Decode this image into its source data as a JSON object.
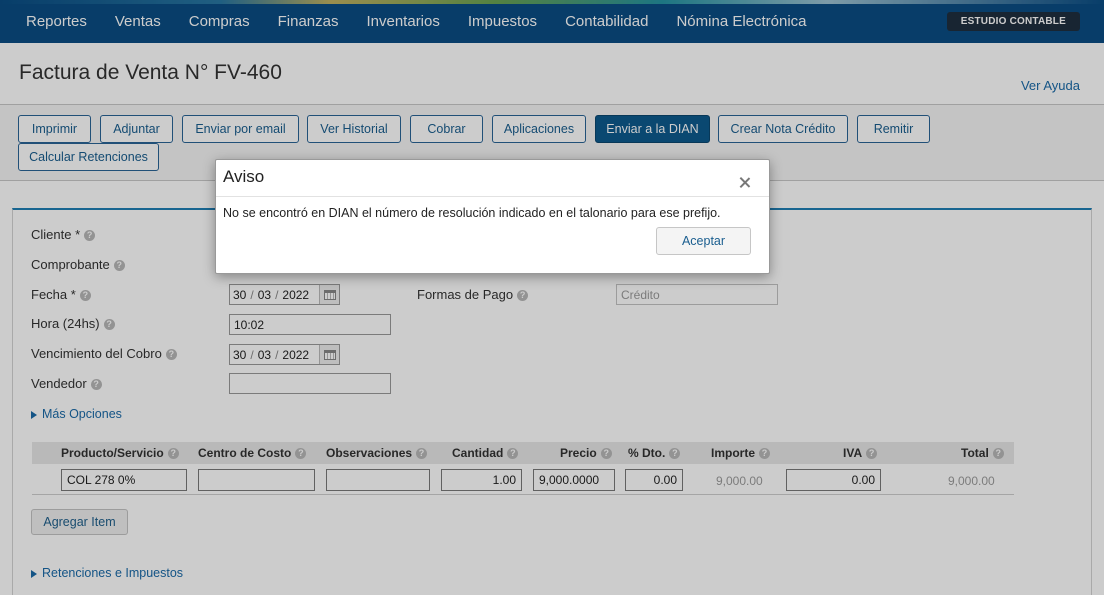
{
  "nav": {
    "items": [
      "Reportes",
      "Ventas",
      "Compras",
      "Finanzas",
      "Inventarios",
      "Impuestos",
      "Contabilidad",
      "Nómina Electrónica"
    ],
    "studio_label": "ESTUDIO CONTABLE"
  },
  "page": {
    "title": "Factura de Venta N° FV-460",
    "help_link": "Ver Ayuda"
  },
  "toolbar": {
    "buttons": [
      "Imprimir",
      "Adjuntar",
      "Enviar por email",
      "Ver Historial",
      "Cobrar",
      "Aplicaciones",
      "Enviar a la DIAN",
      "Crear Nota Crédito",
      "Remitir",
      "Calcular Retenciones"
    ]
  },
  "form": {
    "labels": {
      "cliente": "Cliente *",
      "comprobante": "Comprobante",
      "fecha": "Fecha *",
      "hora": "Hora (24hs)",
      "vencimiento": "Vencimiento del Cobro",
      "vendedor": "Vendedor",
      "formas_pago": "Formas de Pago"
    },
    "fecha": {
      "day": "30",
      "month": "03",
      "year": "2022"
    },
    "hora_value": "10:02",
    "vencimiento": {
      "day": "30",
      "month": "03",
      "year": "2022"
    },
    "vendedor_value": "",
    "formas_pago_placeholder": "Crédito",
    "mas_opciones": "Más Opciones"
  },
  "items_table": {
    "headers": [
      "Producto/Servicio",
      "Centro de Costo",
      "Observaciones",
      "Cantidad",
      "Precio",
      "% Dto.",
      "Importe",
      "IVA",
      "Total"
    ],
    "row": {
      "producto": "COL 278 0%",
      "centro_costo": "",
      "observaciones": "",
      "cantidad": "1.00",
      "precio": "9,000.0000",
      "dto": "0.00",
      "importe": "9,000.00",
      "iva": "0.00",
      "total": "9,000.00"
    },
    "add_item": "Agregar Item"
  },
  "retenciones_link": "Retenciones e Impuestos",
  "dialog": {
    "title": "Aviso",
    "message": "No se encontró en DIAN el número de resolución indicado en el talonario para ese prefijo.",
    "accept": "Aceptar"
  },
  "colors": {
    "nav_bg": "#0a4d84",
    "primary_button": "#0d5a8e",
    "link": "#1a6aa8",
    "panel_accent": "#1f7fb5"
  },
  "icons": [
    "help-icon",
    "calendar-icon",
    "close-icon",
    "expand-triangle-icon"
  ]
}
